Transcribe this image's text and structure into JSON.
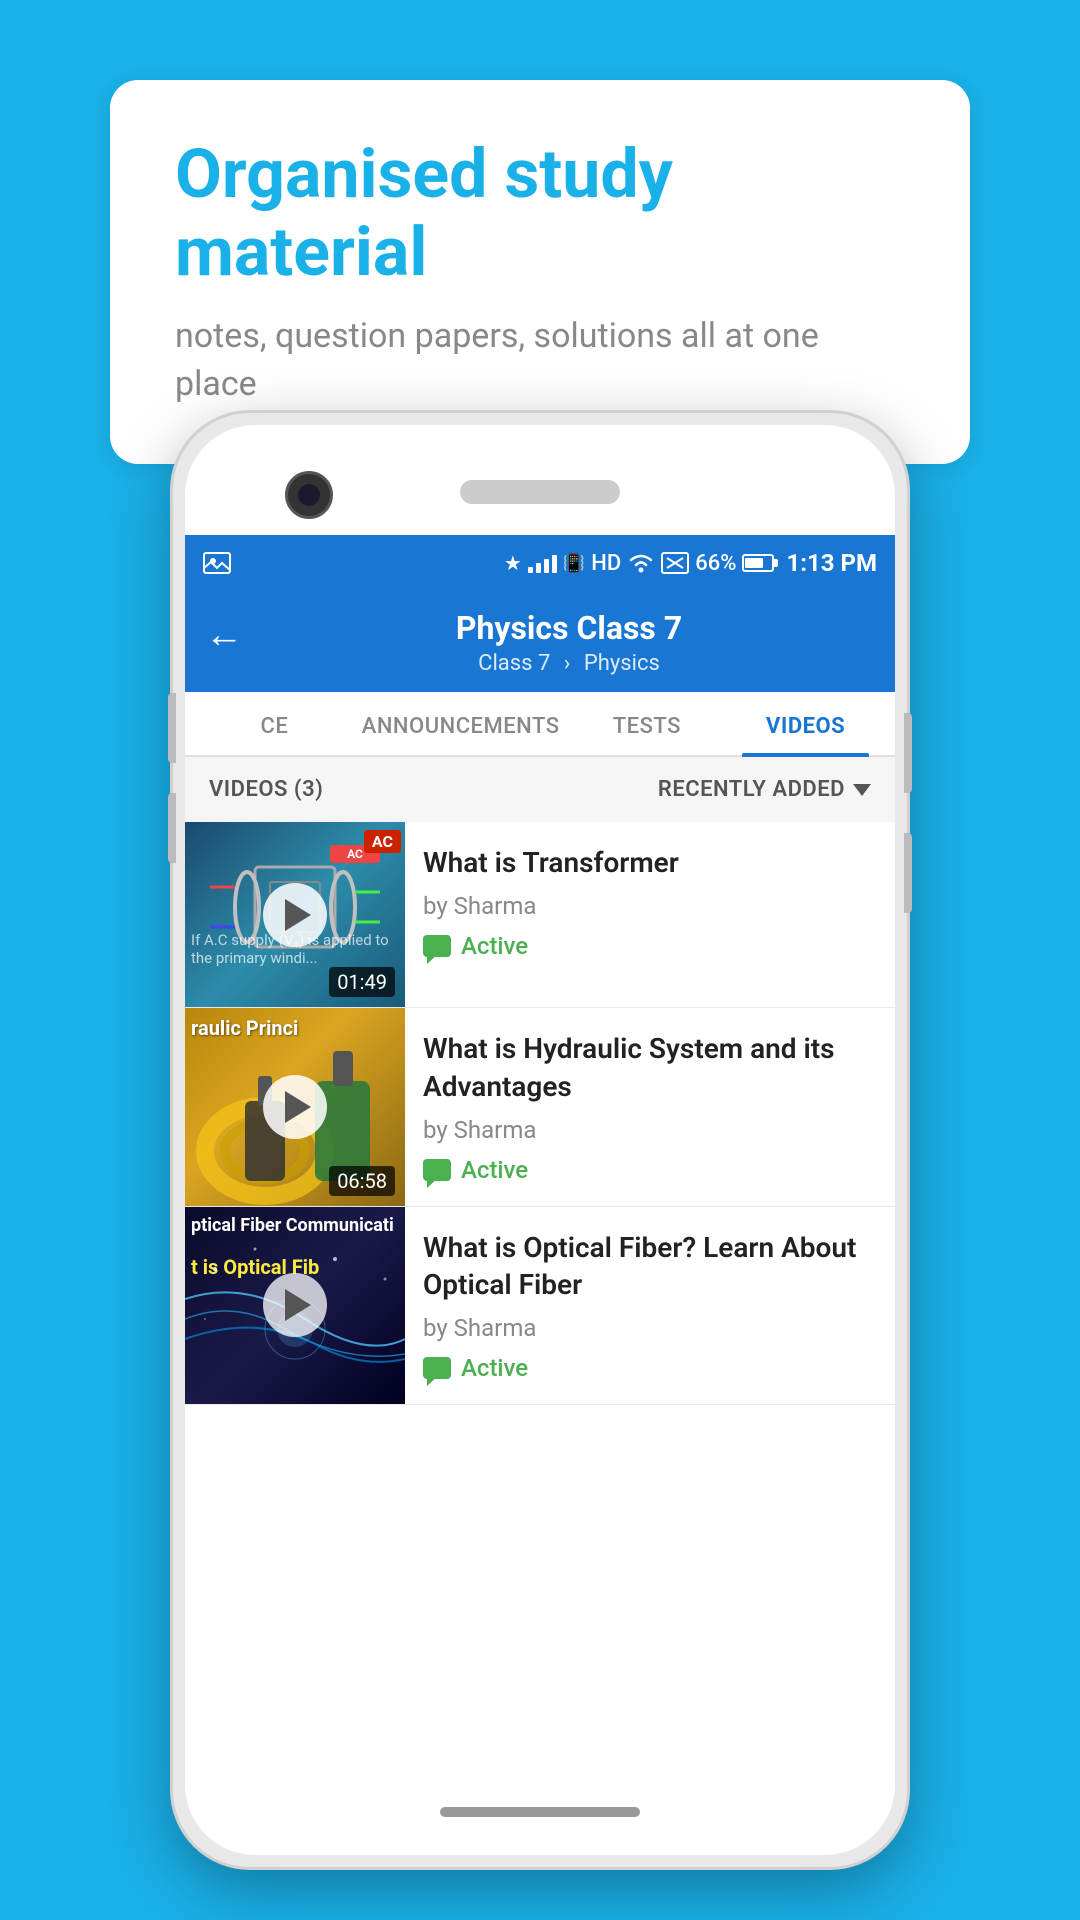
{
  "background_color": "#1ab0e8",
  "bubble": {
    "title": "Organised study material",
    "subtitle": "notes, question papers, solutions all at one place"
  },
  "status_bar": {
    "time": "1:13 PM",
    "battery": "66%",
    "signal": "HD"
  },
  "app_bar": {
    "title": "Physics Class 7",
    "breadcrumb_class": "Class 7",
    "breadcrumb_subject": "Physics",
    "back_label": "←"
  },
  "tabs": [
    {
      "label": "CE",
      "active": false
    },
    {
      "label": "ANNOUNCEMENTS",
      "active": false
    },
    {
      "label": "TESTS",
      "active": false
    },
    {
      "label": "VIDEOS",
      "active": true
    }
  ],
  "filter_bar": {
    "count_label": "VIDEOS (3)",
    "sort_label": "RECENTLY ADDED"
  },
  "videos": [
    {
      "title": "What is  Transformer",
      "author": "by Sharma",
      "status": "Active",
      "duration": "01:49",
      "thumb_label": ""
    },
    {
      "title": "What is Hydraulic System and its Advantages",
      "author": "by Sharma",
      "status": "Active",
      "duration": "06:58",
      "thumb_label": "raulic Princi"
    },
    {
      "title": "What is Optical Fiber? Learn About Optical Fiber",
      "author": "by Sharma",
      "status": "Active",
      "duration": "",
      "thumb_label": "ptical Fiber Communicati"
    }
  ]
}
